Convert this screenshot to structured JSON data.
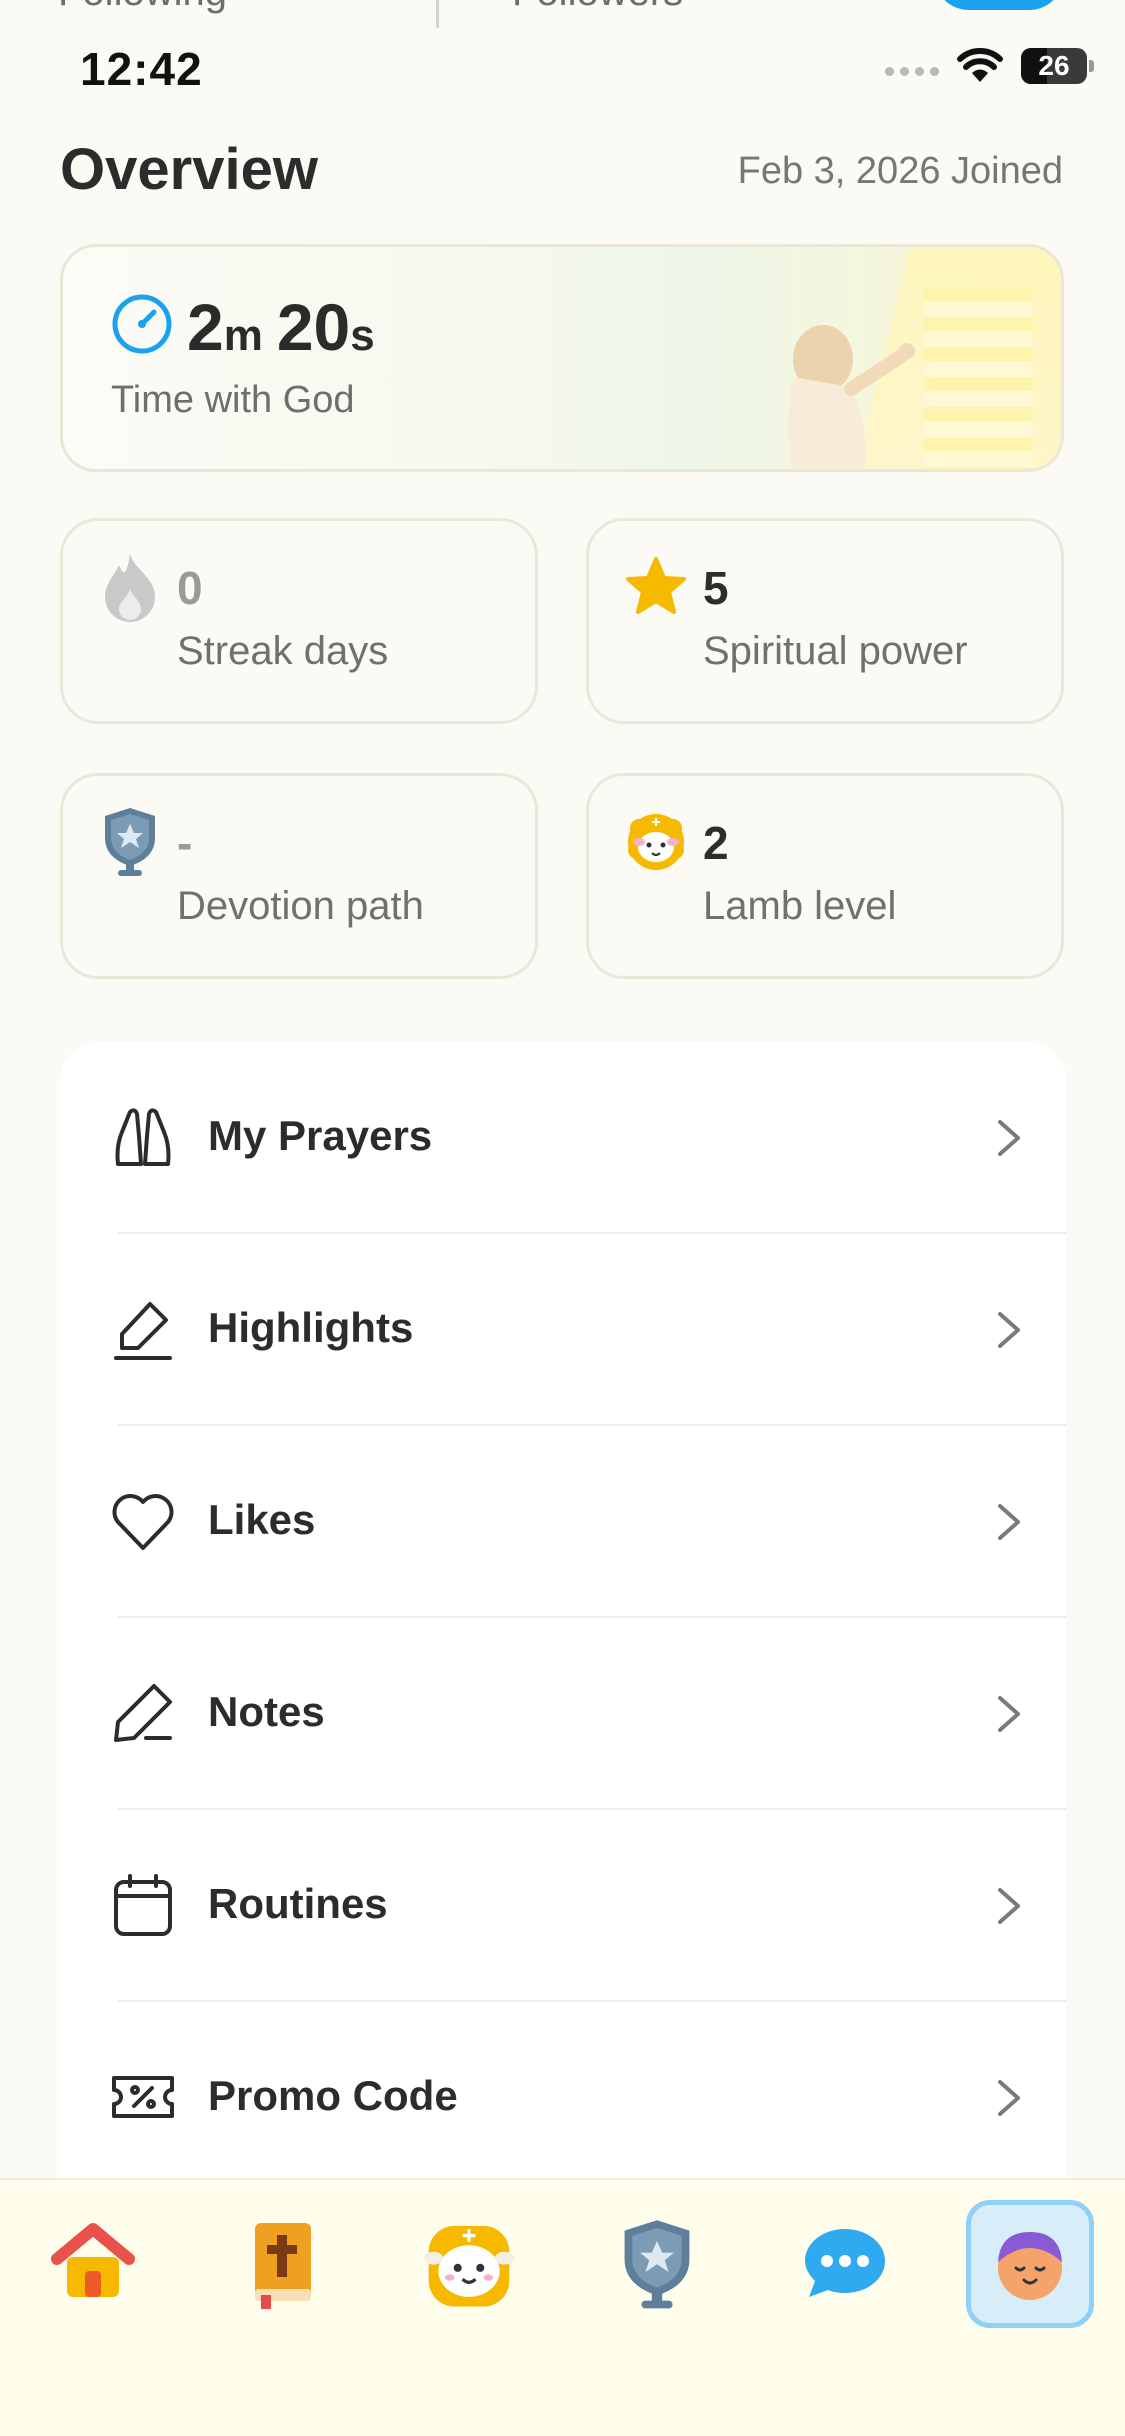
{
  "top_remnant": {
    "following_label": "Following",
    "followers_label": "Followers"
  },
  "status_bar": {
    "time": "12:42",
    "battery": "26"
  },
  "overview": {
    "title": "Overview",
    "joined": "Feb 3, 2026 Joined"
  },
  "time_card": {
    "minutes": "2",
    "minutes_unit": "m",
    "seconds": "20",
    "seconds_unit": "s",
    "label": "Time with God"
  },
  "stats": {
    "streak": {
      "value": "0",
      "label": "Streak days",
      "icon": "flame-icon"
    },
    "spiritual": {
      "value": "5",
      "label": "Spiritual power",
      "icon": "star-icon"
    },
    "devotion": {
      "value": "-",
      "label": "Devotion path",
      "icon": "shield-badge-icon"
    },
    "lamb": {
      "value": "2",
      "label": "Lamb level",
      "icon": "lamb-icon"
    }
  },
  "menu": {
    "items": [
      {
        "label": "My Prayers",
        "icon": "praying-hands-icon"
      },
      {
        "label": "Highlights",
        "icon": "highlighter-icon"
      },
      {
        "label": "Likes",
        "icon": "heart-icon"
      },
      {
        "label": "Notes",
        "icon": "pencil-icon"
      },
      {
        "label": "Routines",
        "icon": "calendar-icon"
      },
      {
        "label": "Promo Code",
        "icon": "ticket-icon"
      }
    ]
  },
  "tab_bar": {
    "tabs": [
      {
        "icon": "home-icon"
      },
      {
        "icon": "bible-icon"
      },
      {
        "icon": "lamb-icon"
      },
      {
        "icon": "shield-badge-icon"
      },
      {
        "icon": "chat-icon"
      },
      {
        "icon": "profile-avatar-icon",
        "active": true
      }
    ]
  },
  "colors": {
    "accent_blue": "#1aa2ef",
    "star": "#f7b800",
    "background": "#fbfaf5",
    "tab_bar": "#fffdec"
  }
}
